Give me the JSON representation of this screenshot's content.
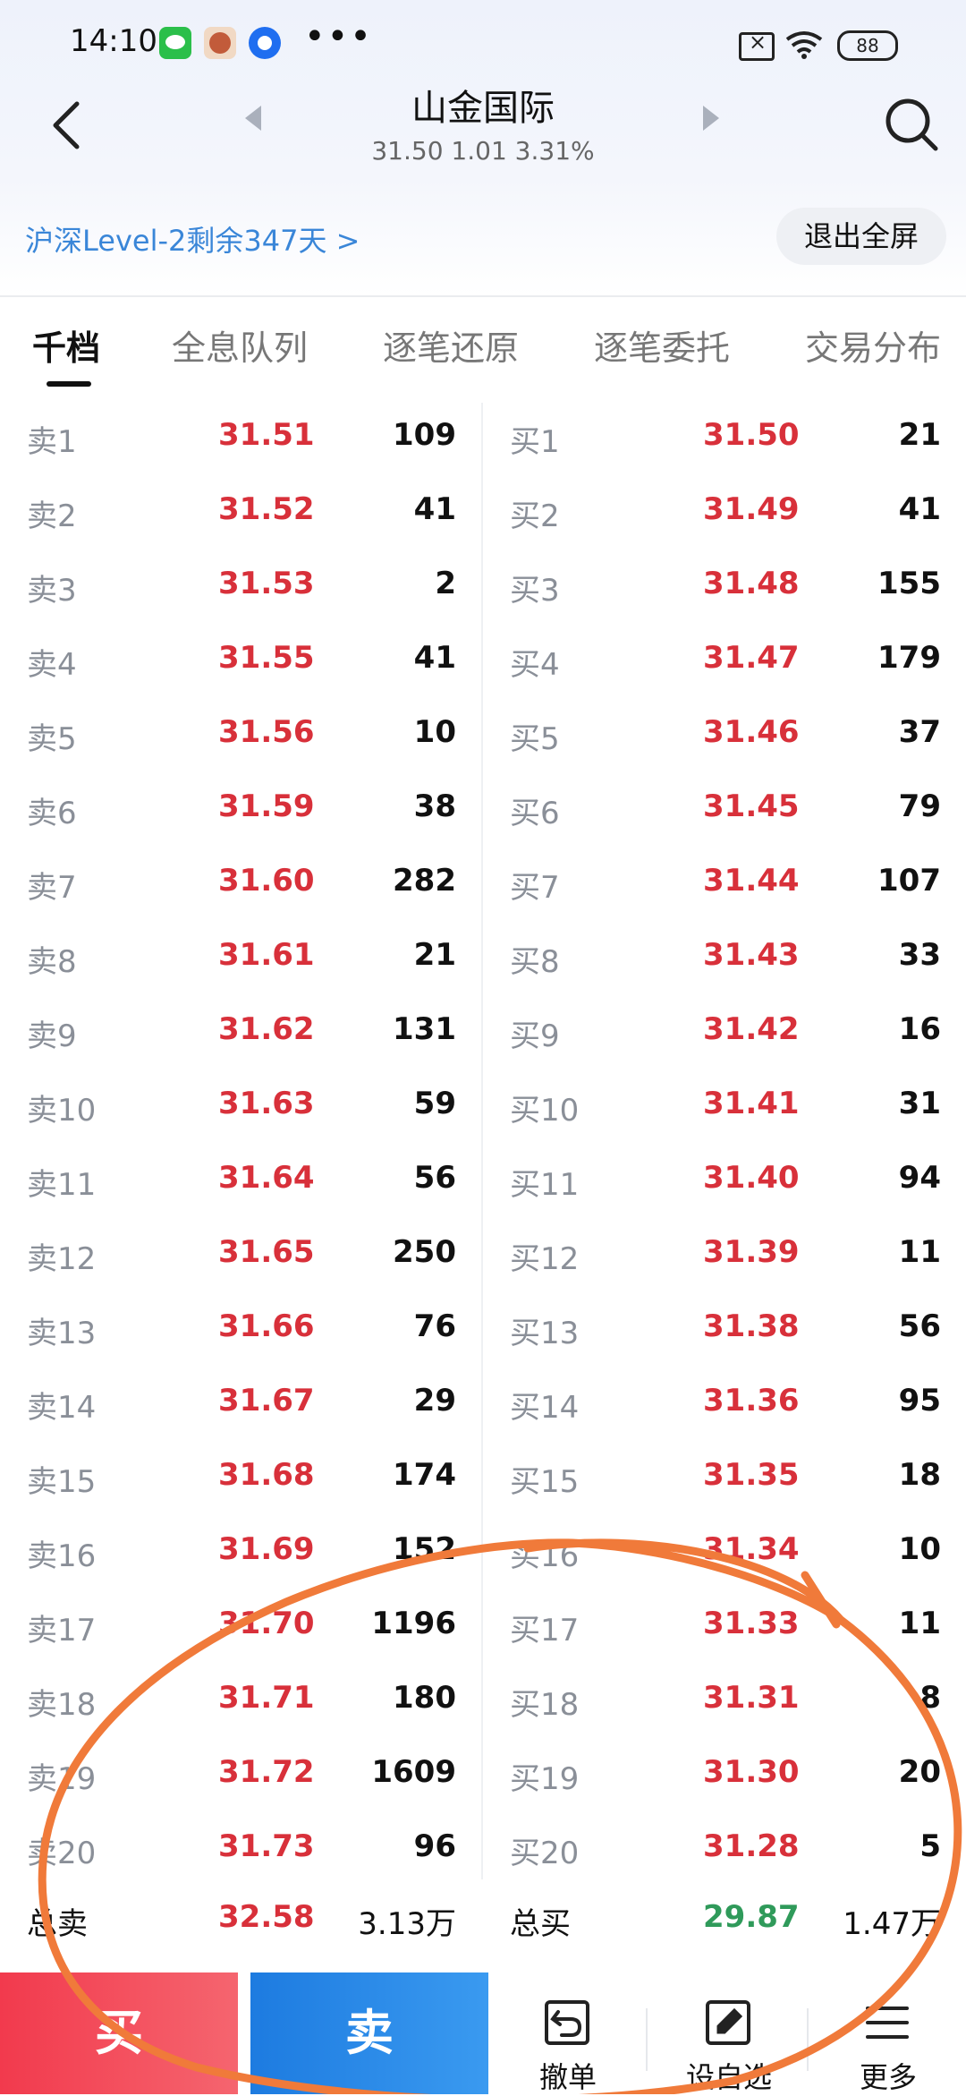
{
  "status_bar": {
    "time": "14:10",
    "more": "•••",
    "battery": "88"
  },
  "header": {
    "title": "山金国际",
    "quote": "31.50 1.01 3.31%"
  },
  "banner": {
    "level2_text": "沪深Level-2剩余347天 >",
    "exit_label": "退出全屏"
  },
  "tabs": [
    {
      "label": "千档",
      "active": true
    },
    {
      "label": "全息队列"
    },
    {
      "label": "逐笔还原"
    },
    {
      "label": "逐笔委托"
    },
    {
      "label": "交易分布"
    }
  ],
  "sell_orders": [
    {
      "label": "卖1",
      "price": "31.51",
      "qty": "109"
    },
    {
      "label": "卖2",
      "price": "31.52",
      "qty": "41"
    },
    {
      "label": "卖3",
      "price": "31.53",
      "qty": "2"
    },
    {
      "label": "卖4",
      "price": "31.55",
      "qty": "41"
    },
    {
      "label": "卖5",
      "price": "31.56",
      "qty": "10"
    },
    {
      "label": "卖6",
      "price": "31.59",
      "qty": "38"
    },
    {
      "label": "卖7",
      "price": "31.60",
      "qty": "282"
    },
    {
      "label": "卖8",
      "price": "31.61",
      "qty": "21"
    },
    {
      "label": "卖9",
      "price": "31.62",
      "qty": "131"
    },
    {
      "label": "卖10",
      "price": "31.63",
      "qty": "59"
    },
    {
      "label": "卖11",
      "price": "31.64",
      "qty": "56"
    },
    {
      "label": "卖12",
      "price": "31.65",
      "qty": "250"
    },
    {
      "label": "卖13",
      "price": "31.66",
      "qty": "76"
    },
    {
      "label": "卖14",
      "price": "31.67",
      "qty": "29"
    },
    {
      "label": "卖15",
      "price": "31.68",
      "qty": "174"
    },
    {
      "label": "卖16",
      "price": "31.69",
      "qty": "152"
    },
    {
      "label": "卖17",
      "price": "31.70",
      "qty": "1196"
    },
    {
      "label": "卖18",
      "price": "31.71",
      "qty": "180"
    },
    {
      "label": "卖19",
      "price": "31.72",
      "qty": "1609"
    },
    {
      "label": "卖20",
      "price": "31.73",
      "qty": "96"
    }
  ],
  "buy_orders": [
    {
      "label": "买1",
      "price": "31.50",
      "qty": "21"
    },
    {
      "label": "买2",
      "price": "31.49",
      "qty": "41"
    },
    {
      "label": "买3",
      "price": "31.48",
      "qty": "155"
    },
    {
      "label": "买4",
      "price": "31.47",
      "qty": "179"
    },
    {
      "label": "买5",
      "price": "31.46",
      "qty": "37"
    },
    {
      "label": "买6",
      "price": "31.45",
      "qty": "79"
    },
    {
      "label": "买7",
      "price": "31.44",
      "qty": "107"
    },
    {
      "label": "买8",
      "price": "31.43",
      "qty": "33"
    },
    {
      "label": "买9",
      "price": "31.42",
      "qty": "16"
    },
    {
      "label": "买10",
      "price": "31.41",
      "qty": "31"
    },
    {
      "label": "买11",
      "price": "31.40",
      "qty": "94"
    },
    {
      "label": "买12",
      "price": "31.39",
      "qty": "11"
    },
    {
      "label": "买13",
      "price": "31.38",
      "qty": "56"
    },
    {
      "label": "买14",
      "price": "31.36",
      "qty": "95"
    },
    {
      "label": "买15",
      "price": "31.35",
      "qty": "18"
    },
    {
      "label": "买16",
      "price": "31.34",
      "qty": "10"
    },
    {
      "label": "买17",
      "price": "31.33",
      "qty": "11"
    },
    {
      "label": "买18",
      "price": "31.31",
      "qty": "8"
    },
    {
      "label": "买19",
      "price": "31.30",
      "qty": "20"
    },
    {
      "label": "买20",
      "price": "31.28",
      "qty": "5"
    }
  ],
  "totals": {
    "sell_label": "总卖",
    "sell_price": "32.58",
    "sell_qty": "3.13万",
    "buy_label": "总买",
    "buy_price": "29.87",
    "buy_qty": "1.47万"
  },
  "bottom_bar": {
    "buy_label": "买",
    "sell_label": "卖",
    "tools": [
      {
        "label": "撤单",
        "icon": "withdraw-icon"
      },
      {
        "label": "设自选",
        "icon": "edit-icon"
      },
      {
        "label": "更多",
        "icon": "menu-icon"
      }
    ]
  },
  "colors": {
    "price_red": "#d8303a",
    "price_green": "#2f9a5a",
    "buy_button": "#f23a4d",
    "sell_button": "#1d7be0",
    "link_blue": "#3a86d8",
    "annotation_orange": "#f07a3a"
  }
}
